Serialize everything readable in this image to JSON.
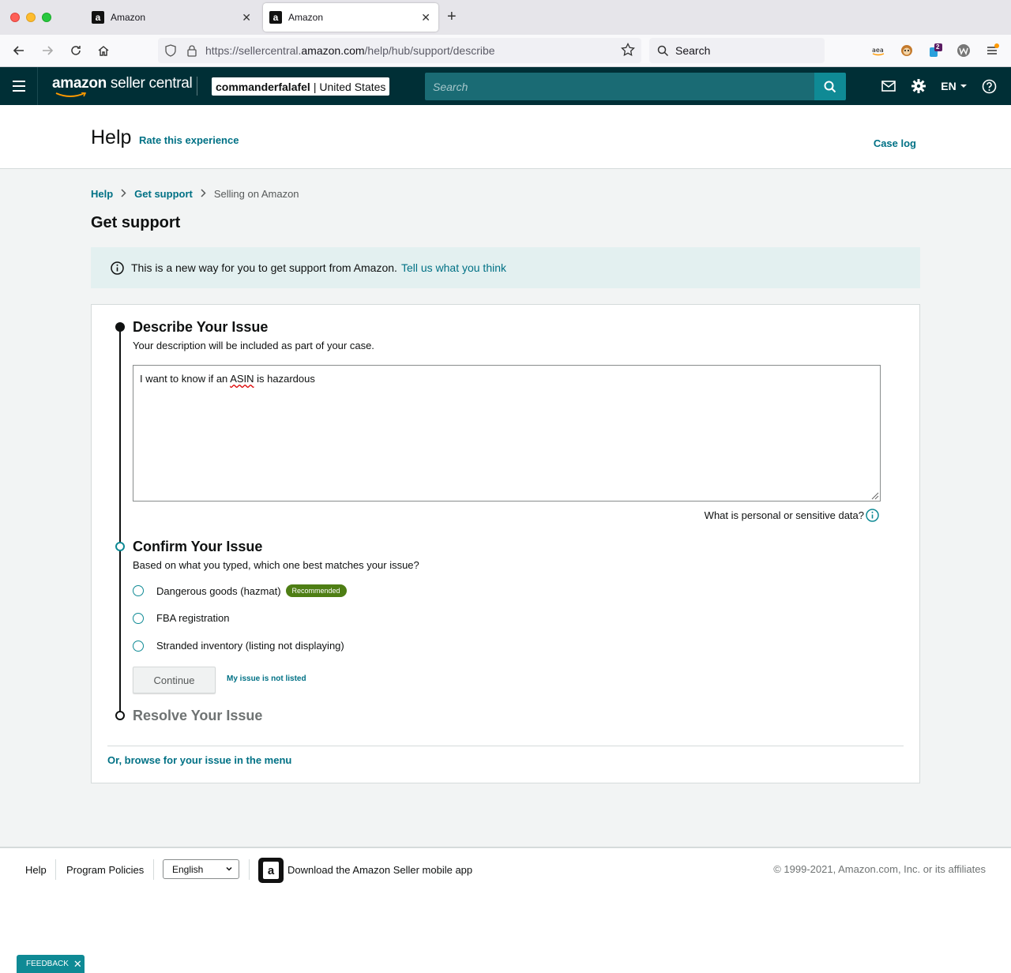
{
  "browser": {
    "tabs": [
      {
        "title": "Amazon",
        "favicon": "a"
      },
      {
        "title": "Amazon",
        "favicon": "a"
      }
    ],
    "url_prefix": "https://sellercentral.",
    "url_domain": "amazon.com",
    "url_path": "/help/hub/support/describe",
    "search_placeholder": "Search",
    "extension_badge": "2"
  },
  "header": {
    "logo_bold": "amazon",
    "logo_rest": " seller central",
    "account_name": "commanderfalafel",
    "account_region": "| United States",
    "search_placeholder": "Search",
    "language": "EN"
  },
  "help_header": {
    "title": "Help",
    "rate_link": "Rate this experience",
    "case_log": "Case log"
  },
  "breadcrumb": {
    "items": [
      "Help",
      "Get support",
      "Selling on Amazon"
    ]
  },
  "page_title": "Get support",
  "banner": {
    "text": "This is a new way for you to get support from Amazon.",
    "link": "Tell us what you think"
  },
  "steps": {
    "describe": {
      "title": "Describe Your Issue",
      "subtitle": "Your description will be included as part of your case.",
      "textarea_before": "I want to know if an ",
      "textarea_misspelled": "ASIN",
      "textarea_after": " is hazardous",
      "sensitive_link": "What is personal or sensitive data?"
    },
    "confirm": {
      "title": "Confirm Your Issue",
      "subtitle": "Based on what you typed, which one best matches your issue?",
      "options": [
        {
          "label": "Dangerous goods (hazmat)",
          "badge": "Recommended"
        },
        {
          "label": "FBA registration"
        },
        {
          "label": "Stranded inventory (listing not displaying)"
        }
      ],
      "continue_label": "Continue",
      "not_listed": "My issue is not listed"
    },
    "resolve": {
      "title": "Resolve Your Issue"
    }
  },
  "browse_link": "Or, browse for your issue in the menu",
  "footer": {
    "help": "Help",
    "program_policies": "Program Policies",
    "language": "English",
    "download_app": "Download the Amazon Seller mobile app",
    "copyright": "© 1999-2021, Amazon.com, Inc. or its affiliates"
  },
  "feedback_label": "FEEDBACK",
  "colors": {
    "header_bg": "#002f36",
    "link": "#007185",
    "accent_teal": "#0f8a95",
    "badge_green": "#4e7e14",
    "banner_bg": "#e3f0f0"
  }
}
